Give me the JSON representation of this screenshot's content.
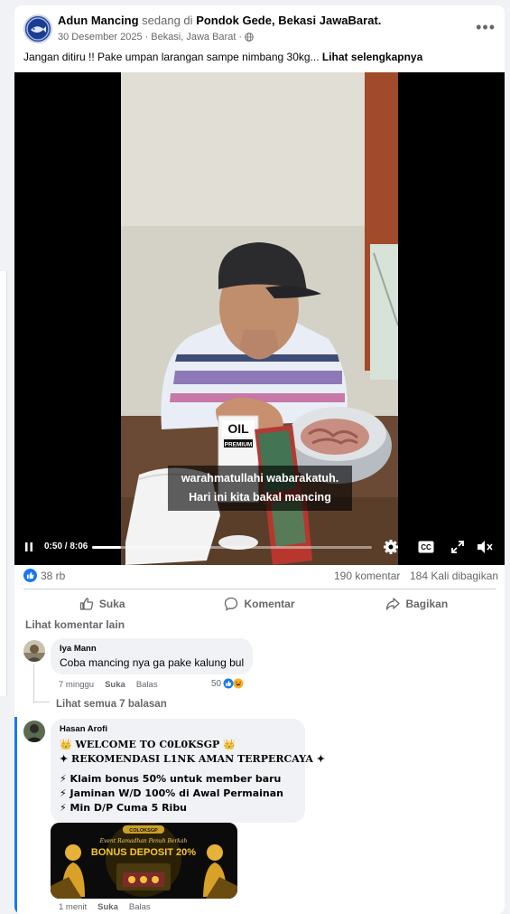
{
  "post": {
    "author": "Adun Mancing",
    "activity_text": "sedang di",
    "place": "Pondok Gede, Bekasi JawaBarat.",
    "date": "30 Desember 2025",
    "location": "Bekasi, Jawa Barat",
    "caption": "Jangan ditiru !! Pake umpan larangan sampe nimbang 30kg...",
    "see_more": "Lihat selengkapnya"
  },
  "video": {
    "subtitle_line1": "warahmatullahi wabarakatuh.",
    "subtitle_line2": "Hari ini kita bakal mancing",
    "time": "0:50 / 8:06",
    "progress_fraction": 0.103,
    "pack_label": "OIL",
    "pack_sublabel": "PREMIUM"
  },
  "stats": {
    "reactions": "38 rb",
    "comments": "190 komentar",
    "shares": "184 Kali dibagikan"
  },
  "actions": {
    "like": "Suka",
    "comment": "Komentar",
    "share": "Bagikan"
  },
  "more_comments": "Lihat komentar lain",
  "comments": [
    {
      "name": "Iya Mann",
      "text": "Coba mancing nya ga pake kalung bul",
      "time": "7 minggu",
      "like": "Suka",
      "reply": "Balas",
      "reactions": "50",
      "view_replies": "Lihat semua 7 balasan"
    },
    {
      "name": "Hasan Arofi",
      "lines": [
        "👑 WELCOME TO C0L0KSGP 👑",
        "✦ REKOMENDASI L1NK AMAN TERPERCAYA ✦",
        "⚡ Klaim bonus 50% untuk member baru",
        "⚡ Jaminan W/D 100% di Awal Permainan",
        "⚡ Min D/P Cuma 5 Ribu"
      ],
      "time": "1 menit",
      "like": "Suka",
      "reply": "Balas",
      "image": {
        "brand": "COLOKSGP",
        "script": "Event Ramadhan Penuh Berkah",
        "headline": "BONUS DEPOSIT 20%"
      }
    }
  ],
  "colors": {
    "accent": "#1877f2",
    "text_secondary": "#65676b",
    "bubble": "#f0f2f5"
  }
}
